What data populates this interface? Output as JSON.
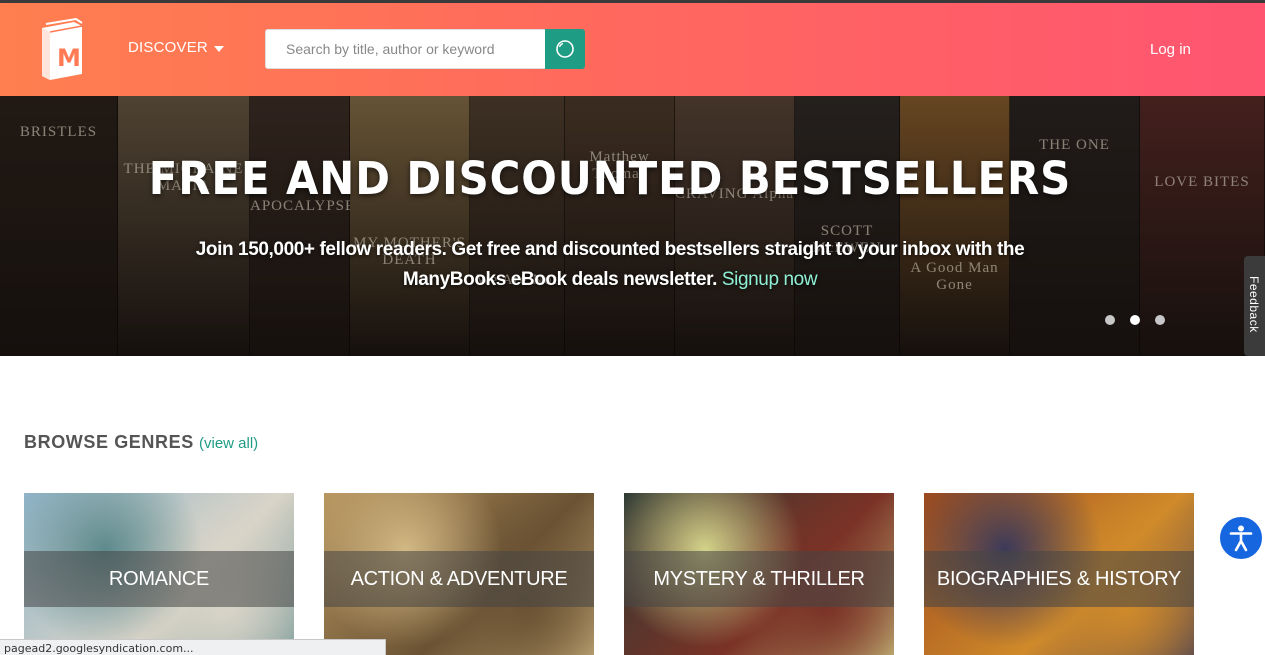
{
  "header": {
    "logo_letter": "M",
    "discover_label": "DISCOVER",
    "search_placeholder": "Search by title, author or keyword",
    "search_value": "",
    "login_label": "Log in",
    "colors": {
      "gradient_start": "#ff7f50",
      "gradient_end": "#ff5571",
      "search_button": "#1f9c84"
    },
    "icons": {
      "discover_caret": "caret-down-icon",
      "search": "search-icon"
    }
  },
  "hero": {
    "title": "FREE AND DISCOUNTED BESTSELLERS",
    "subtitle": "Join 150,000+ fellow readers. Get free and discounted bestsellers straight to your inbox with the ManyBooks eBook deals newsletter.",
    "signup_label": "Signup now",
    "slide_count": 3,
    "active_slide": 2,
    "book_covers": [
      {
        "text": "BRISTLES",
        "color": "#2b2119"
      },
      {
        "text": "THE MIGRAINE MAFIA",
        "color": "#6a5a44"
      },
      {
        "text": "APOCALYPSE",
        "color": "#3d2e25"
      },
      {
        "text": "MY MOTHER'S DEATH",
        "color": "#8a7148"
      },
      {
        "text": "We Are Not",
        "color": "#52402f"
      },
      {
        "text": "Matthew Thomas",
        "color": "#4e3b2b"
      },
      {
        "text": "CRAVING Alpha",
        "color": "#5a4637"
      },
      {
        "text": "SCOTT McEWEN",
        "color": "#2f2a26"
      },
      {
        "text": "A Good Man Gone",
        "color": "#8a5e2c"
      },
      {
        "text": "THE ONE",
        "color": "#2a2421"
      },
      {
        "text": "LOVE BITES",
        "color": "#5a2a26"
      }
    ],
    "feedback_label": "Feedback"
  },
  "genres": {
    "heading": "BROWSE GENRES",
    "view_all_label": "(view all)",
    "items": [
      {
        "label": "ROMANCE",
        "colors": [
          "#8fb4c8",
          "#d9d4c8",
          "#5e8a8c"
        ]
      },
      {
        "label": "ACTION & ADVENTURE",
        "colors": [
          "#b89660",
          "#6a5233",
          "#d2b883"
        ]
      },
      {
        "label": "MYSTERY & THRILLER",
        "colors": [
          "#2e3a34",
          "#7a3226",
          "#d4d38a"
        ]
      },
      {
        "label": "BIOGRAPHIES & HISTORY",
        "colors": [
          "#9c4a1e",
          "#d08a2a",
          "#3c3a5a"
        ]
      }
    ]
  },
  "accessibility": {
    "icon": "accessibility-icon",
    "color": "#1666e0"
  },
  "status_bar": {
    "text": "pagead2.googlesyndication.com..."
  }
}
